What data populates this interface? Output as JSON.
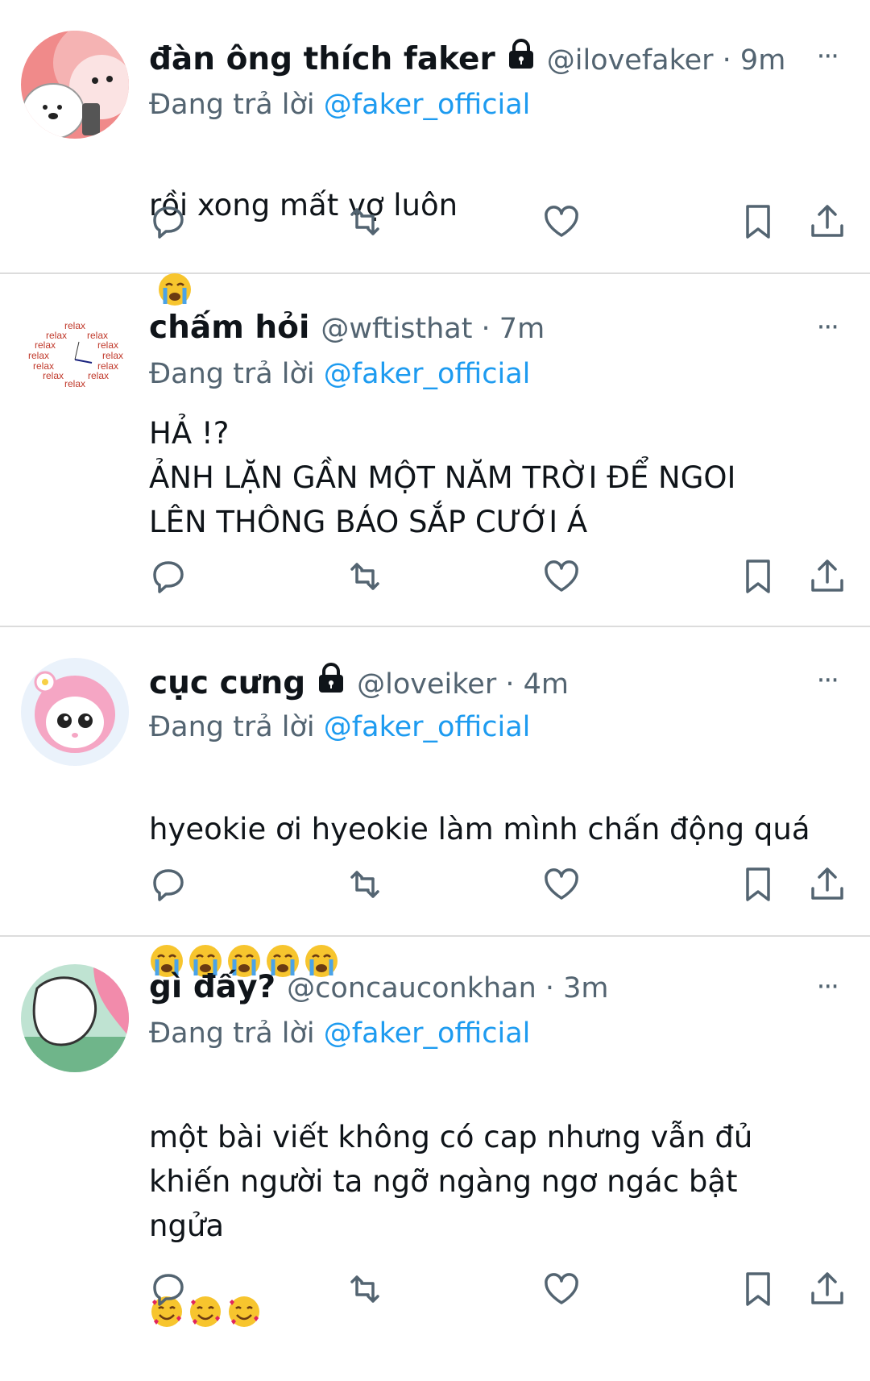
{
  "tweets": [
    {
      "name": "đàn ông thích faker",
      "locked": true,
      "handle": "@ilovefaker · 9m",
      "reply_prefix": "Đang trả lời",
      "reply_to": "@faker_official",
      "text": "rồi xong mất vợ luôn",
      "emoji": [
        "crying-face"
      ]
    },
    {
      "name": "chấm hỏi",
      "locked": false,
      "handle": "@wftisthat · 7m",
      "reply_prefix": "Đang trả lời",
      "reply_to": "@faker_official",
      "text": "HẢ !?\nẢNH LẶN GẦN MỘT NĂM TRỜI ĐỂ NGOI\nLÊN THÔNG BÁO SẮP CƯỚI Á",
      "avatar_text": "relax"
    },
    {
      "name": "cục cưng",
      "locked": true,
      "handle": "@loveiker · 4m",
      "reply_prefix": "Đang trả lời",
      "reply_to": "@faker_official",
      "text": "hyeokie ơi hyeokie làm mình chấn động quá",
      "emoji": [
        "crying-face",
        "crying-face",
        "crying-face",
        "crying-face",
        "crying-face"
      ]
    },
    {
      "name": "gì đấy?",
      "locked": false,
      "handle": "@concauconkhan · 3m",
      "reply_prefix": "Đang trả lời",
      "reply_to": "@faker_official",
      "text": "một bài viết không có cap nhưng vẫn đủ\nkhiến người ta ngỡ ngàng ngơ ngác bật\nngửa",
      "emoji": [
        "smiling-face-with-hearts",
        "smiling-face-with-hearts",
        "smiling-face-with-hearts"
      ]
    }
  ],
  "more_label": "···",
  "colors": {
    "accent": "#1d9bf0",
    "secondary": "#536471",
    "text": "#0f1419",
    "divider": "#dcdcdc"
  }
}
